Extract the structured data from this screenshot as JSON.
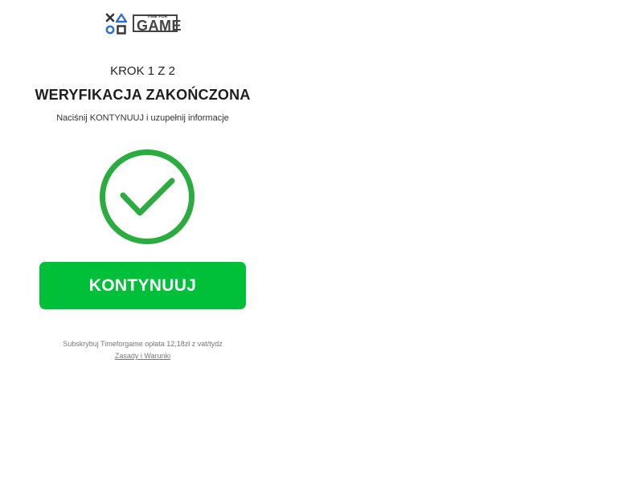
{
  "logo": {
    "small_text": "TIME FOR",
    "word": "GAME",
    "brand_color": "#2f6fce"
  },
  "step": {
    "label": "KROK 1 Z 2"
  },
  "title": "WERYFIKACJA ZAKOŃCZONA",
  "subtitle": "Naciśnij KONTYNUUJ i uzupełnij informacje",
  "status_icon": {
    "name": "checkmark-circle-icon",
    "color": "#2aac3e"
  },
  "cta": {
    "label": "KONTYNUUJ",
    "color": "#00c03a"
  },
  "footer": {
    "pricing": "Subskrybuj Timeforgame opłata 12,18zł z vat/tydz",
    "terms_link": "Zasady i Warunki"
  }
}
